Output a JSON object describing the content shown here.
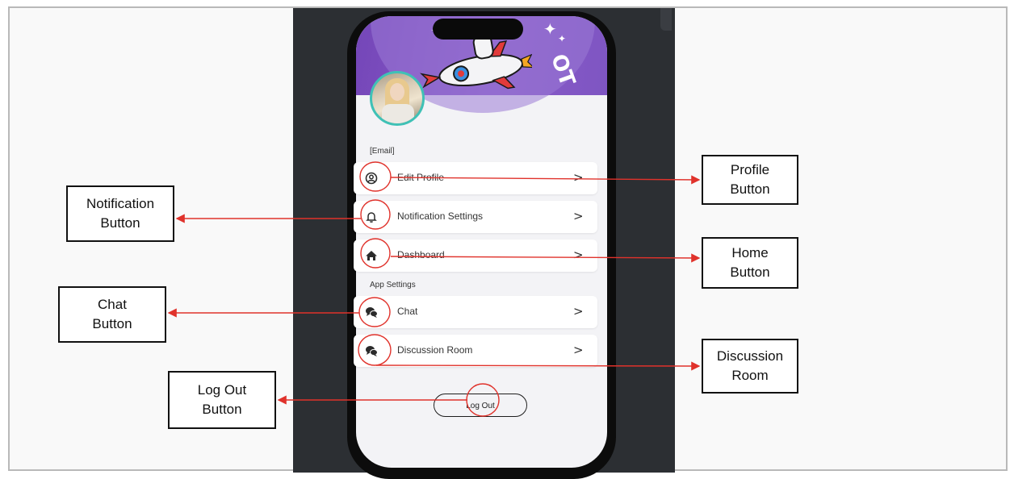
{
  "phone": {
    "header_text": "OT",
    "email_label": "[Email]",
    "app_settings_label": "App Settings",
    "menu_items": [
      {
        "label": "Edit Profile",
        "icon": "user-circle-icon"
      },
      {
        "label": "Notification Settings",
        "icon": "bell-icon"
      },
      {
        "label": "Dashboard",
        "icon": "home-icon"
      },
      {
        "label": "Chat",
        "icon": "chat-bubbles-icon"
      },
      {
        "label": "Discussion Room",
        "icon": "chat-bubbles-icon"
      }
    ],
    "chevron": ">",
    "logout_label": "Log Out"
  },
  "callouts": {
    "profile": {
      "line1": "Profile",
      "line2": "Button"
    },
    "notification": {
      "line1": "Notification",
      "line2": "Button"
    },
    "home": {
      "line1": "Home",
      "line2": "Button"
    },
    "chat": {
      "line1": "Chat",
      "line2": "Button"
    },
    "discussion": {
      "line1": "Discussion",
      "line2": "Room"
    },
    "logout": {
      "line1": "Log Out",
      "line2": "Button"
    }
  },
  "colors": {
    "annotation_red": "#e0322b",
    "header_purple": "#7e52c2",
    "avatar_ring": "#3fc1b6"
  }
}
